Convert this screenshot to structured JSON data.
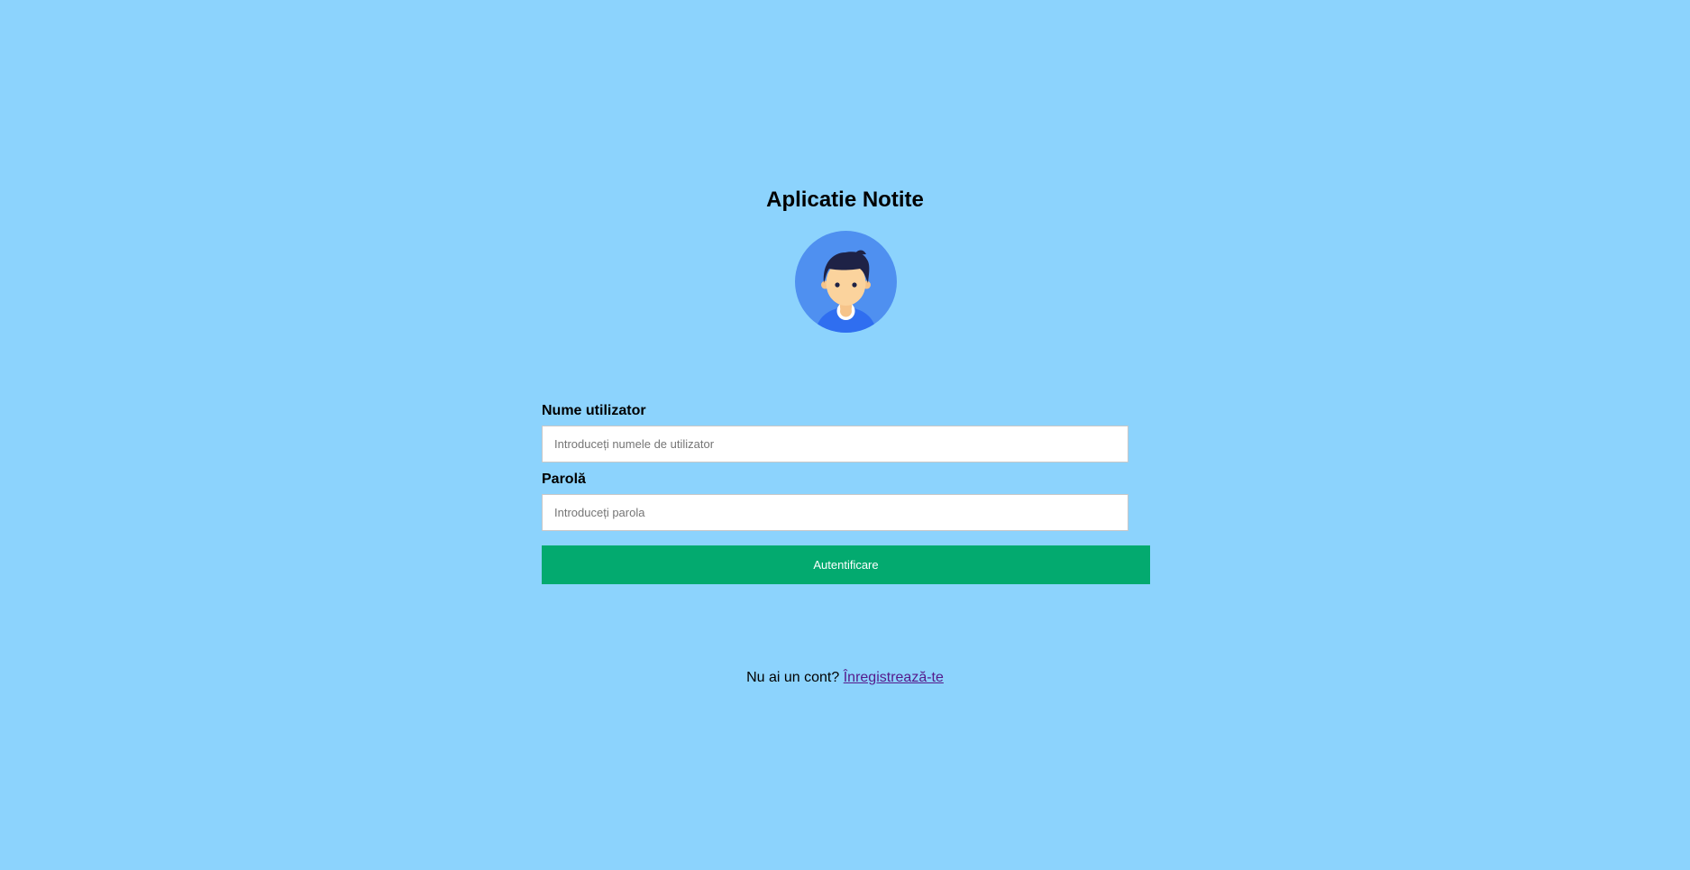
{
  "app": {
    "title": "Aplicatie Notite"
  },
  "login_form": {
    "username_label": "Nume utilizator",
    "username_placeholder": "Introduceți numele de utilizator",
    "username_value": "",
    "password_label": "Parolă",
    "password_placeholder": "Introduceți parola",
    "password_value": "",
    "submit_label": "Autentificare"
  },
  "register": {
    "prompt": "Nu ai un cont? ",
    "link_label": "Înregistrează-te"
  },
  "icons": {
    "avatar": "user-avatar-icon"
  },
  "colors": {
    "background": "#8cd3fd",
    "submit_button": "#03aa6f",
    "avatar_circle": "#4f90f0",
    "link": "#551a8b"
  }
}
